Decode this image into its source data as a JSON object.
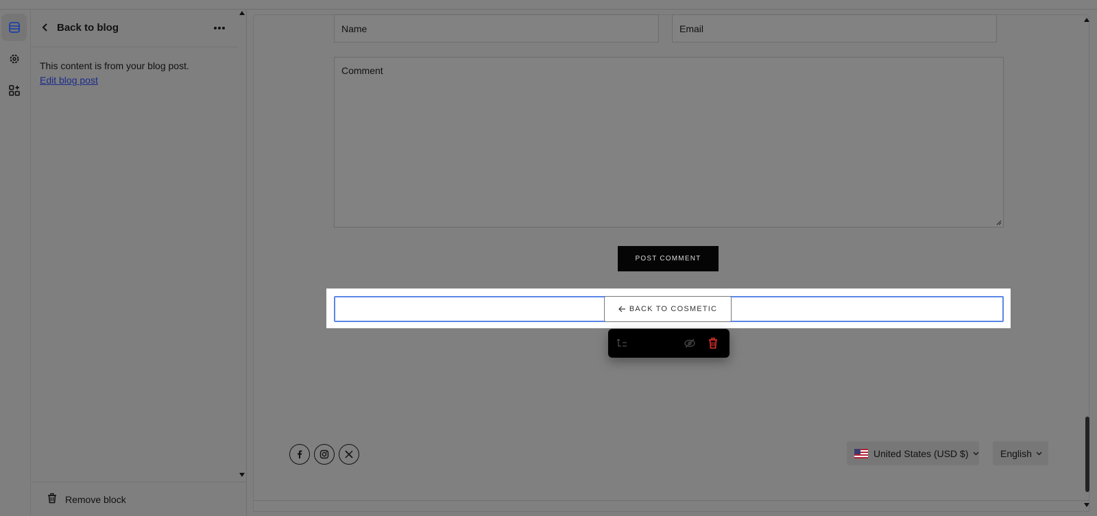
{
  "panel": {
    "title": "Back to blog",
    "note": "This content is from your blog post.",
    "edit_link": "Edit blog post",
    "remove_label": "Remove block"
  },
  "form": {
    "name_placeholder": "Name",
    "email_placeholder": "Email",
    "comment_placeholder": "Comment",
    "post_button": "POST COMMENT"
  },
  "selected_block": {
    "back_button": "BACK TO COSMETIC"
  },
  "footer": {
    "social": [
      "facebook-icon",
      "instagram-icon",
      "x-icon"
    ],
    "country_selector": "United States (USD $)",
    "language_selector": "English"
  },
  "colors": {
    "selection_outline": "#5a86e8",
    "delete_icon": "#e0322e",
    "link": "#1a2b8a"
  }
}
